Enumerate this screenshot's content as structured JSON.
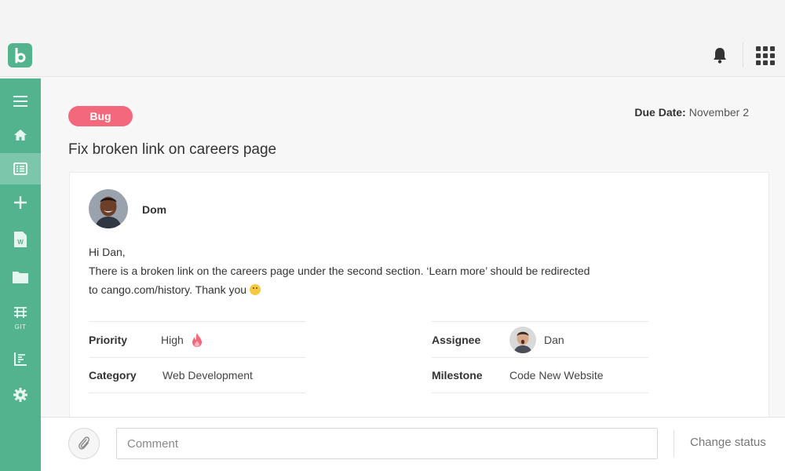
{
  "header": {
    "logo_icon": "app-logo-b",
    "notification_icon": "bell-icon",
    "apps_icon": "grid-icon"
  },
  "sidebar": {
    "items": [
      {
        "icon": "menu-icon"
      },
      {
        "icon": "home-icon"
      },
      {
        "icon": "list-icon",
        "active": true
      },
      {
        "icon": "plus-icon"
      },
      {
        "icon": "document-icon"
      },
      {
        "icon": "folder-icon"
      },
      {
        "icon": "git-icon",
        "label": "GIT"
      },
      {
        "icon": "chart-icon"
      },
      {
        "icon": "gear-icon"
      }
    ],
    "accent_color": "#53b38f",
    "active_color": "#7cc7ab"
  },
  "task": {
    "tag": "Bug",
    "tag_color": "#f4687c",
    "due_label": "Due Date:",
    "due_value": "November 2",
    "title": "Fix broken link on careers page"
  },
  "comment_card": {
    "author": "Dom",
    "greeting": "Hi Dan,",
    "line1": "There is a broken link on the careers page under the second section. ‘Learn more’ should be redirected",
    "line2": "to cango.com/history. Thank you"
  },
  "properties": {
    "priority_label": "Priority",
    "priority_value": "High",
    "priority_icon": "fire-icon",
    "category_label": "Category",
    "category_value": "Web Development",
    "assignee_label": "Assignee",
    "assignee_value": "Dan",
    "milestone_label": "Milestone",
    "milestone_value": "Code New Website"
  },
  "footer": {
    "attach_icon": "paperclip-icon",
    "comment_placeholder": "Comment",
    "change_status_label": "Change status"
  }
}
